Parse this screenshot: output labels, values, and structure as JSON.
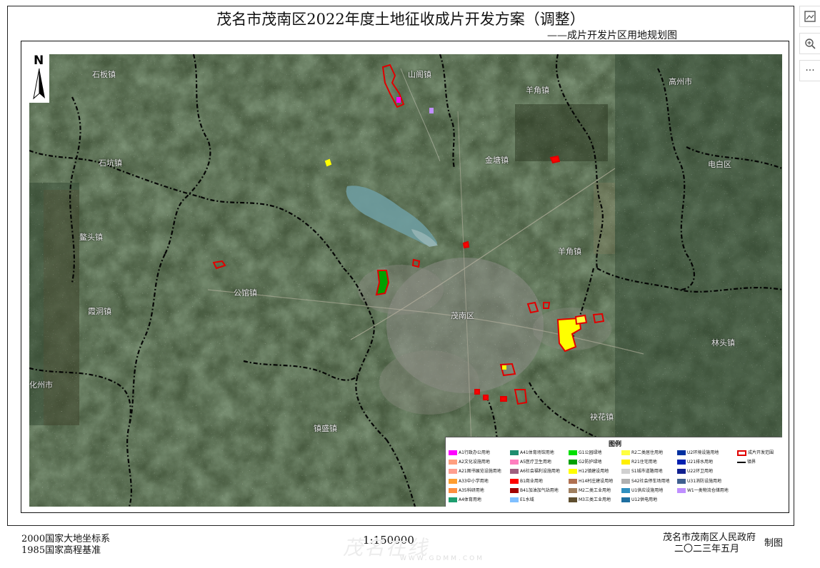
{
  "title": "茂名市茂南区2022年度土地征收成片开发方案（调整）",
  "subtitle": "——成片开发片区用地规划图",
  "north_label": "N",
  "place_names": [
    "石板镇",
    "石坑镇",
    "鳌头镇",
    "羊角镇",
    "山阁镇",
    "金塘镇",
    "公馆镇",
    "茂南区",
    "镇盛镇",
    "霞洞镇",
    "林头镇",
    "羊角镇",
    "袂花镇",
    "高州市",
    "化州市",
    "电白区"
  ],
  "legend": {
    "title": "图例",
    "items": [
      {
        "code": "A1",
        "label": "A1行政办公用地",
        "color": "#ff00ff"
      },
      {
        "code": "A2",
        "label": "A2文化设施用地",
        "color": "#ff9f7f"
      },
      {
        "code": "A21",
        "label": "A21图书展览设施用地",
        "color": "#ff9f8f"
      },
      {
        "code": "A33",
        "label": "A33中小学用地",
        "color": "#ff9e2f"
      },
      {
        "code": "A35",
        "label": "A35科研用地",
        "color": "#ff8f3f"
      },
      {
        "code": "A4",
        "label": "A4体育用地",
        "color": "#1e9e6f"
      },
      {
        "code": "A41",
        "label": "A41体育场馆用地",
        "color": "#1e8e6f"
      },
      {
        "code": "A5",
        "label": "A5医疗卫生用地",
        "color": "#ff7fbf"
      },
      {
        "code": "A6",
        "label": "A6社会福利设施用地",
        "color": "#9f5f7f"
      },
      {
        "code": "B1",
        "label": "B1商业用地",
        "color": "#ff0000"
      },
      {
        "code": "B41",
        "label": "B41加油加气站用地",
        "color": "#a00000"
      },
      {
        "code": "E1",
        "label": "E1水域",
        "color": "#7fbfff"
      },
      {
        "code": "G1",
        "label": "G1公园绿地",
        "color": "#00e000"
      },
      {
        "code": "G2",
        "label": "G2防护绿地",
        "color": "#00a000"
      },
      {
        "code": "H12",
        "label": "H12镇建设用地",
        "color": "#ffff00"
      },
      {
        "code": "H14",
        "label": "H14村庄建设用地",
        "color": "#b07050"
      },
      {
        "code": "M2",
        "label": "M2二类工业用地",
        "color": "#9f7f5f"
      },
      {
        "code": "M3",
        "label": "M3三类工业用地",
        "color": "#5f4f2f"
      },
      {
        "code": "R2",
        "label": "R2二类居住用地",
        "color": "#ffff40"
      },
      {
        "code": "R21",
        "label": "R21住宅用地",
        "color": "#ffef00"
      },
      {
        "code": "S1",
        "label": "S1城市道路用地",
        "color": "#d0d0d0"
      },
      {
        "code": "S42",
        "label": "S42社会停车场用地",
        "color": "#b0b0b0"
      },
      {
        "code": "U1",
        "label": "U1供应设施用地",
        "color": "#2f8fbf"
      },
      {
        "code": "U12",
        "label": "U12供电用地",
        "color": "#1f6fa0"
      },
      {
        "code": "U2",
        "label": "U2环境设施用地",
        "color": "#0030a0"
      },
      {
        "code": "U21",
        "label": "U21排水用地",
        "color": "#0020b0"
      },
      {
        "code": "U22",
        "label": "U22环卫用地",
        "color": "#102090"
      },
      {
        "code": "U31",
        "label": "U31消防设施用地",
        "color": "#3f5f8f"
      },
      {
        "code": "W1",
        "label": "W1一类物流仓储用地",
        "color": "#bf8fff"
      },
      {
        "code": "boundary",
        "label": "成片开发范围",
        "color": "#e00000"
      },
      {
        "code": "town",
        "label": "镇界",
        "color": "#000000"
      }
    ]
  },
  "footer": {
    "coord_system": "2000国家大地坐标系",
    "height_datum": "1985国家高程基准",
    "scale": "1:150000",
    "publisher": "茂名市茂南区人民政府",
    "date": "二〇二三年五月",
    "made_by": "制图"
  },
  "toolbar": {
    "image_icon": "image-icon",
    "zoom_icon": "zoom-in-icon",
    "more_label": "···"
  },
  "watermark": {
    "text": "茂名在线",
    "url": "WWW.GDMM.COM"
  }
}
